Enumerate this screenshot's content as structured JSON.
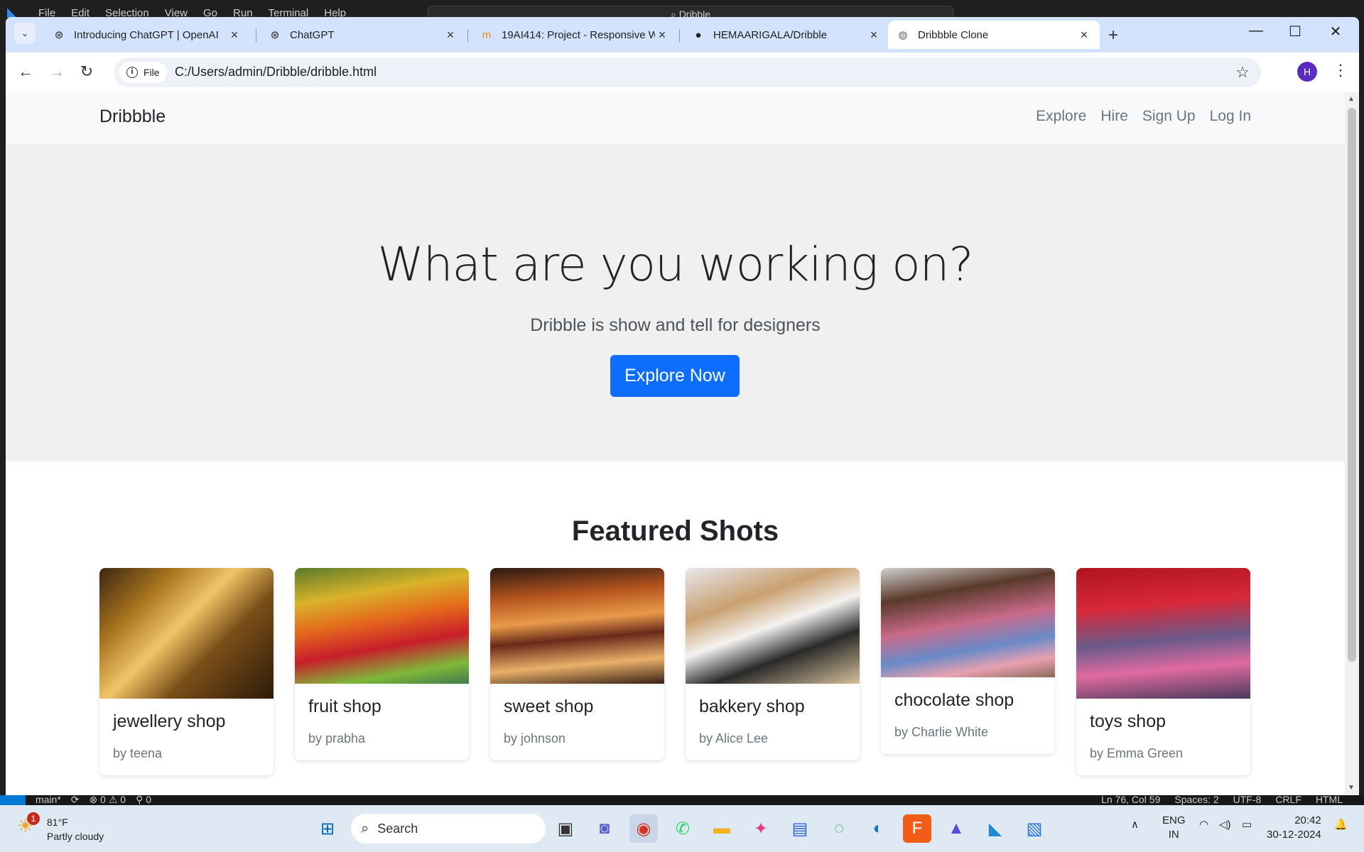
{
  "vscode": {
    "menu": [
      "File",
      "Edit",
      "Selection",
      "View",
      "Go",
      "Run",
      "Terminal",
      "Help"
    ],
    "search": "Dribble",
    "status_left": [
      "main*",
      "⟳",
      "⊗ 0 ⚠ 0",
      "⚲ 0"
    ],
    "status_right": [
      "Ln 76, Col 59",
      "Spaces: 2",
      "UTF-8",
      "CRLF",
      "HTML"
    ]
  },
  "browser": {
    "tabs": [
      {
        "title": "Introducing ChatGPT | OpenAI",
        "icon": "openai-icon"
      },
      {
        "title": "ChatGPT",
        "icon": "openai-icon"
      },
      {
        "title": "19AI414: Project - Responsive W",
        "icon": "moodle-icon"
      },
      {
        "title": "HEMAARIGALA/Dribble",
        "icon": "github-icon"
      },
      {
        "title": "Dribbble Clone",
        "icon": "globe-icon"
      }
    ],
    "address": {
      "chip": "File",
      "url": "C:/Users/admin/Dribble/dribble.html"
    },
    "profile_initial": "H"
  },
  "site": {
    "brand": "Dribbble",
    "nav": [
      "Explore",
      "Hire",
      "Sign Up",
      "Log In"
    ],
    "hero": {
      "title": "What are you working on?",
      "subtitle": "Dribble is show and tell for designers",
      "cta": "Explore Now"
    },
    "featured_title": "Featured Shots",
    "shots": [
      {
        "title": "jewellery shop",
        "author": "by teena"
      },
      {
        "title": "fruit shop",
        "author": "by prabha"
      },
      {
        "title": "sweet shop",
        "author": "by johnson"
      },
      {
        "title": "bakkery shop",
        "author": "by Alice Lee"
      },
      {
        "title": "chocolate shop",
        "author": "by Charlie White"
      },
      {
        "title": "toys shop",
        "author": "by Emma Green"
      }
    ],
    "accent": "#0d6efd"
  },
  "taskbar": {
    "weather_badge": "1",
    "temp": "81°F",
    "condition": "Partly cloudy",
    "search": "Search",
    "lang": "ENG",
    "region": "IN",
    "time": "20:42",
    "date": "30-12-2024"
  }
}
